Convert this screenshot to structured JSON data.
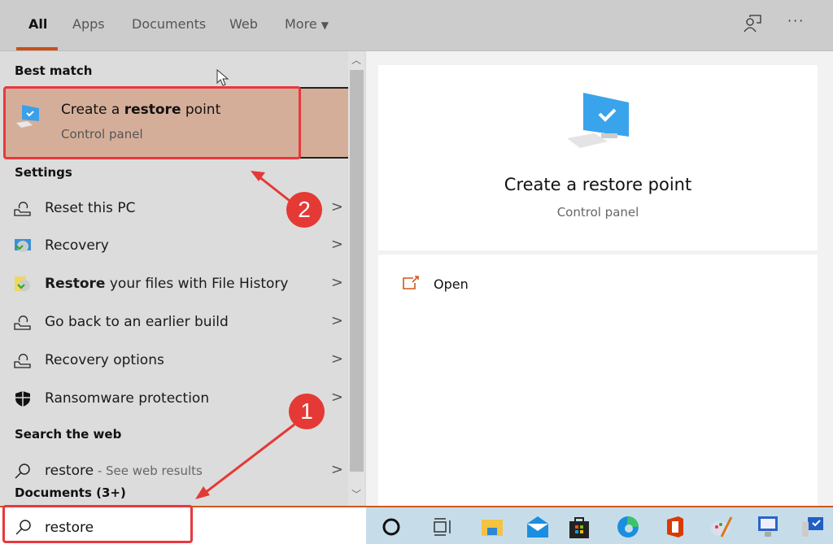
{
  "tabs": [
    {
      "label": "All",
      "active": true
    },
    {
      "label": "Apps"
    },
    {
      "label": "Documents"
    },
    {
      "label": "Web"
    },
    {
      "label": "More"
    }
  ],
  "header_icons": [
    "feedback-icon",
    "more-options-icon"
  ],
  "best_match": {
    "section": "Best match",
    "title_pre": "Create a ",
    "title_bold": "restore",
    "title_post": " point",
    "subtitle": "Control panel"
  },
  "settings": {
    "section": "Settings",
    "items": [
      {
        "label": "Reset this PC",
        "icon": "reset-icon"
      },
      {
        "label": "Recovery",
        "icon": "recovery-icon"
      },
      {
        "bold": "Restore",
        "label": " your files with File History",
        "icon": "file-history-icon"
      },
      {
        "label": "Go back to an earlier build",
        "icon": "reset-icon"
      },
      {
        "label": "Recovery options",
        "icon": "reset-icon"
      },
      {
        "label": "Ransomware protection",
        "icon": "shield-icon"
      }
    ]
  },
  "web": {
    "section": "Search the web",
    "query": "restore",
    "suffix": " - See web results"
  },
  "documents": {
    "section": "Documents (3+)"
  },
  "preview": {
    "title": "Create a restore point",
    "subtitle": "Control panel",
    "action": "Open"
  },
  "search": {
    "value": "restore"
  },
  "taskbar": [
    "cortana",
    "task-view",
    "file-explorer",
    "mail",
    "store",
    "edge",
    "office",
    "paint",
    "control-panel",
    "system"
  ],
  "annotations": {
    "step1": "1",
    "step2": "2",
    "color": "#e53935"
  },
  "colors": {
    "accent": "#d0571f",
    "highlight": "#d5ae99"
  }
}
